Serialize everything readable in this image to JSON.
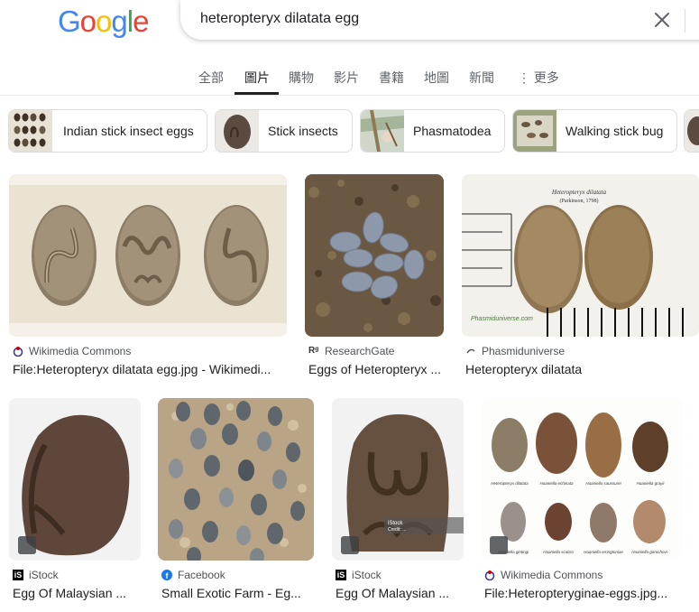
{
  "logo": {
    "letters": [
      "G",
      "o",
      "o",
      "g",
      "l",
      "e"
    ],
    "colors": [
      "#4285f4",
      "#ea4335",
      "#fbbc05",
      "#4285f4",
      "#34a853",
      "#ea4335"
    ]
  },
  "search": {
    "query": "heteropteryx dilatata egg"
  },
  "tabs": [
    {
      "label": "全部"
    },
    {
      "label": "圖片",
      "active": true
    },
    {
      "label": "購物"
    },
    {
      "label": "影片"
    },
    {
      "label": "書籍"
    },
    {
      "label": "地圖"
    },
    {
      "label": "新聞"
    },
    {
      "label": "更多"
    }
  ],
  "chips": [
    {
      "label": "Indian stick insect eggs"
    },
    {
      "label": "Stick insects"
    },
    {
      "label": "Phasmatodea"
    },
    {
      "label": "Walking stick bug"
    }
  ],
  "results": [
    {
      "source": "Wikimedia Commons",
      "title": "File:Heteropteryx dilatata egg.jpg - Wikimedi..."
    },
    {
      "source": "ResearchGate",
      "title": "Eggs of Heteropteryx ..."
    },
    {
      "source": "Phasmiduniverse",
      "title": "Heteropteryx dilatata",
      "caption": "Heteropteryx dilatata",
      "caption2": "(Parkinson, 1798)",
      "watermark": "Phasmiduniverse.com"
    },
    {
      "source": "iStock",
      "title": "Egg Of Malaysian ..."
    },
    {
      "source": "Facebook",
      "title": "Small Exotic Farm - Eg..."
    },
    {
      "source": "iStock",
      "title": "Egg Of Malaysian ...",
      "watermark": "iStock",
      "watermark2": "Credit: ..."
    },
    {
      "source": "Wikimedia Commons",
      "title": "File:Heteropteryginae-eggs.jpg...",
      "egg_labels": [
        "Heteropteryx dilatata",
        "Haaniella echinata",
        "Haaniella saussurei",
        "Haaniella grayii",
        "Haaniella gintingi",
        "Haaniella scabra",
        "Haaniella erringtoniae",
        "Haaniella gorochovi"
      ]
    }
  ]
}
